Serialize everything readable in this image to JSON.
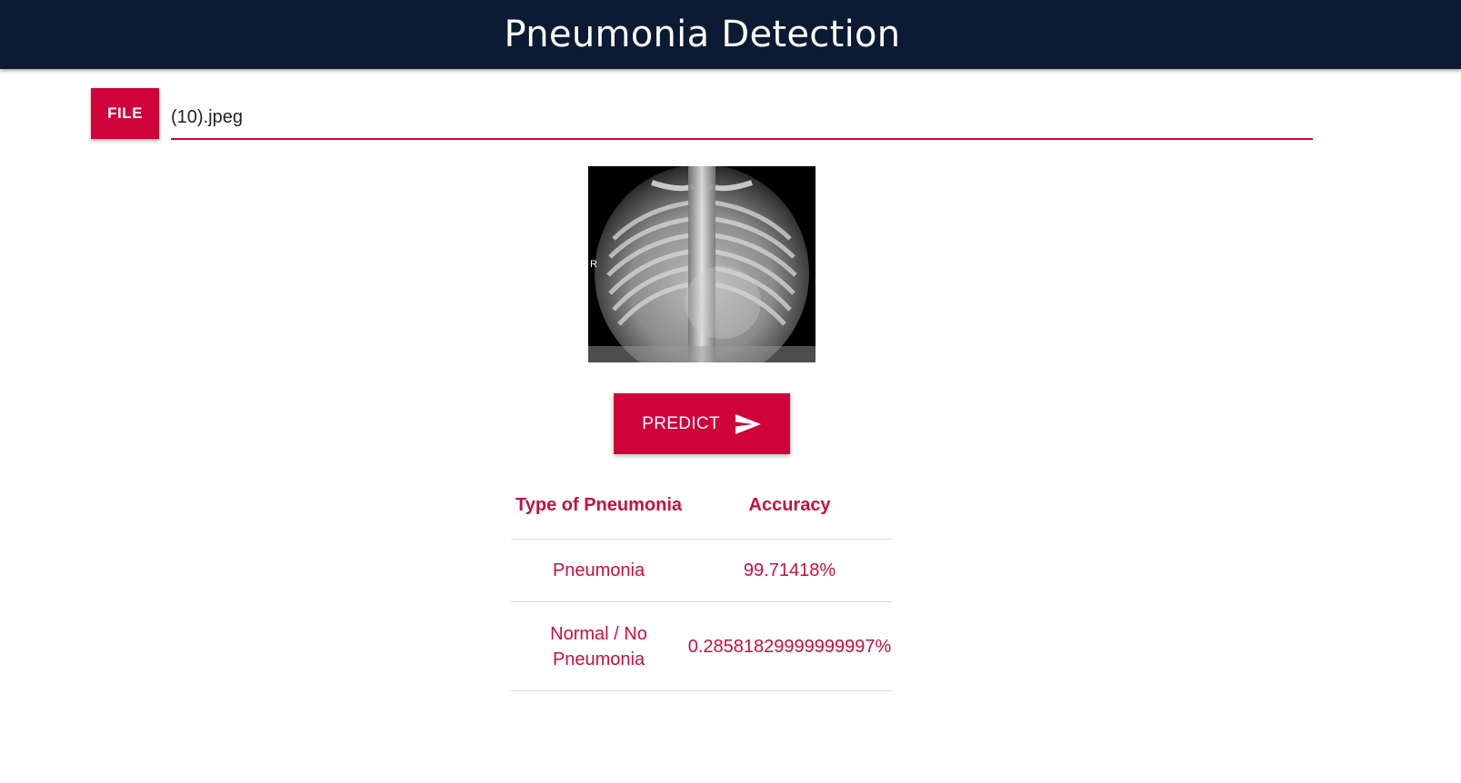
{
  "header": {
    "title": "Pneumonia Detection"
  },
  "file_picker": {
    "button_label": "FILE",
    "file_name": "(10).jpeg"
  },
  "xray_image": {
    "marker_letter": "R",
    "icon": "chest-xray-image"
  },
  "predict": {
    "label": "PREDICT",
    "icon": "send-icon"
  },
  "results": {
    "columns": [
      "Type of Pneumonia",
      "Accuracy"
    ],
    "rows": [
      {
        "type": "Pneumonia",
        "accuracy": "99.71418%"
      },
      {
        "type": "Normal / No Pneumonia",
        "accuracy": "0.28581829999999997%"
      }
    ]
  },
  "colors": {
    "header_bg": "#0c1a33",
    "accent": "#d0023a",
    "table_text": "#c8103d"
  }
}
